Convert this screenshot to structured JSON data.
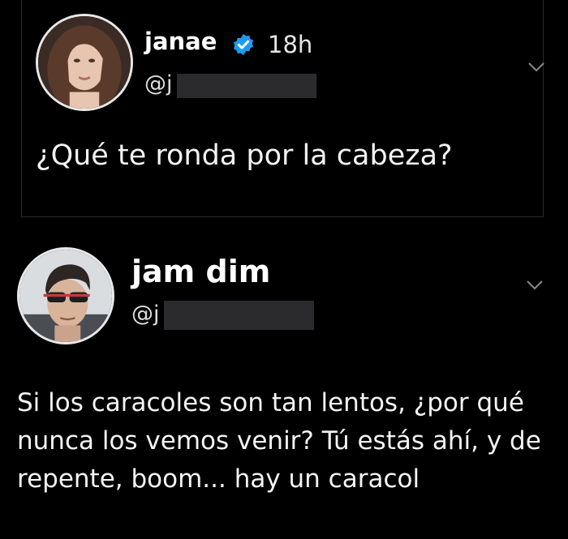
{
  "quoted_post": {
    "author_name": "janae",
    "verified_icon": "verified-badge-icon",
    "time": "18h",
    "handle": "@j",
    "prompt_text": "¿Qué te ronda por la cabeza?"
  },
  "main_post": {
    "author_name": "jam dim",
    "handle": "@j",
    "text_lines": [
      "Si los caracoles son tan lentos, ¿por qué",
      "nunca los vemos venir? Tú estás ahí, y de",
      "repente, boom... hay un caracol"
    ]
  },
  "colors": {
    "background": "#000000",
    "text": "#ffffff",
    "verified": "#1d9bf0",
    "redaction": "#2b2b2d"
  }
}
